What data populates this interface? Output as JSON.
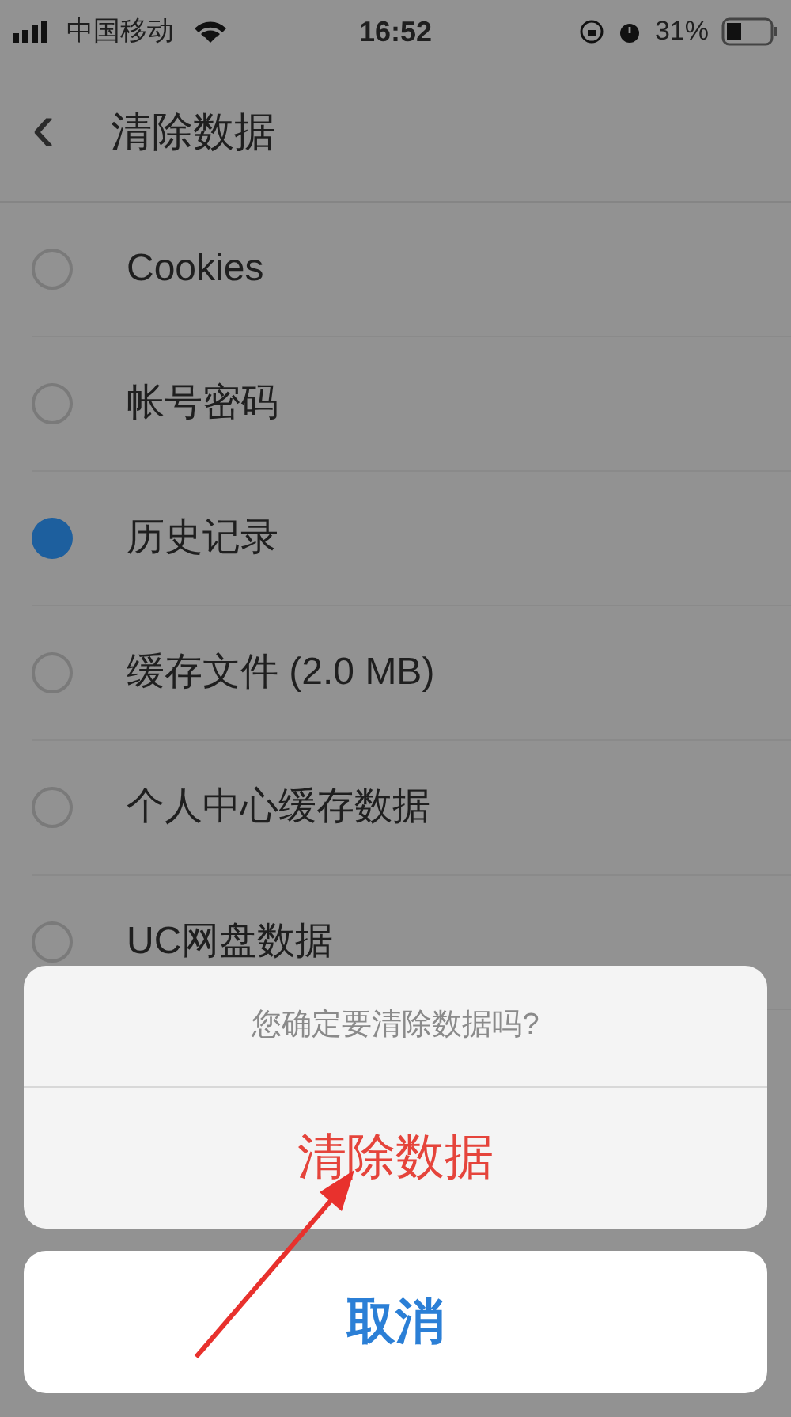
{
  "status_bar": {
    "carrier": "中国移动",
    "time": "16:52",
    "battery": "31%"
  },
  "header": {
    "back": "‹",
    "title": "清除数据"
  },
  "options": [
    {
      "label": "Cookies",
      "selected": false
    },
    {
      "label": "帐号密码",
      "selected": false
    },
    {
      "label": "历史记录",
      "selected": true
    },
    {
      "label": "缓存文件 (2.0 MB)",
      "selected": false
    },
    {
      "label": "个人中心缓存数据",
      "selected": false
    },
    {
      "label": "UC网盘数据",
      "selected": false
    }
  ],
  "action_sheet": {
    "message": "您确定要清除数据吗?",
    "confirm": "清除数据",
    "cancel": "取消"
  }
}
